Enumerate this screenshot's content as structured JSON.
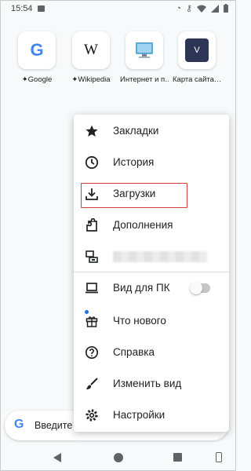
{
  "status_bar": {
    "time": "15:54"
  },
  "tiles": [
    {
      "label": "Google",
      "pinned": true,
      "icon": "google-logo"
    },
    {
      "label": "Wikipedia",
      "pinned": true,
      "icon": "wikipedia-logo",
      "letter": "W"
    },
    {
      "label": "Интернет и п…",
      "pinned": false,
      "icon": "computer-monitor-icon"
    },
    {
      "label": "Карта сайта…",
      "pinned": false,
      "icon": "v-logo",
      "letter": "V"
    }
  ],
  "menu": {
    "items": [
      {
        "label": "Закладки",
        "icon": "star-icon"
      },
      {
        "label": "История",
        "icon": "clock-icon"
      },
      {
        "label": "Загрузки",
        "icon": "download-icon",
        "highlighted": true
      },
      {
        "label": "Дополнения",
        "icon": "puzzle-icon"
      },
      {
        "label": "",
        "icon": "devices-icon",
        "blurred": true
      },
      {
        "label": "Вид для ПК",
        "icon": "laptop-icon",
        "toggle": false
      },
      {
        "label": "Что нового",
        "icon": "gift-icon",
        "badge": true
      },
      {
        "label": "Справка",
        "icon": "help-icon"
      },
      {
        "label": "Изменить вид",
        "icon": "brush-icon"
      },
      {
        "label": "Настройки",
        "icon": "gear-icon"
      }
    ]
  },
  "search": {
    "placeholder": "Введите",
    "logo": "G"
  },
  "colors": {
    "accent": "#1a73e8",
    "highlight_border": "#d93a3a"
  }
}
